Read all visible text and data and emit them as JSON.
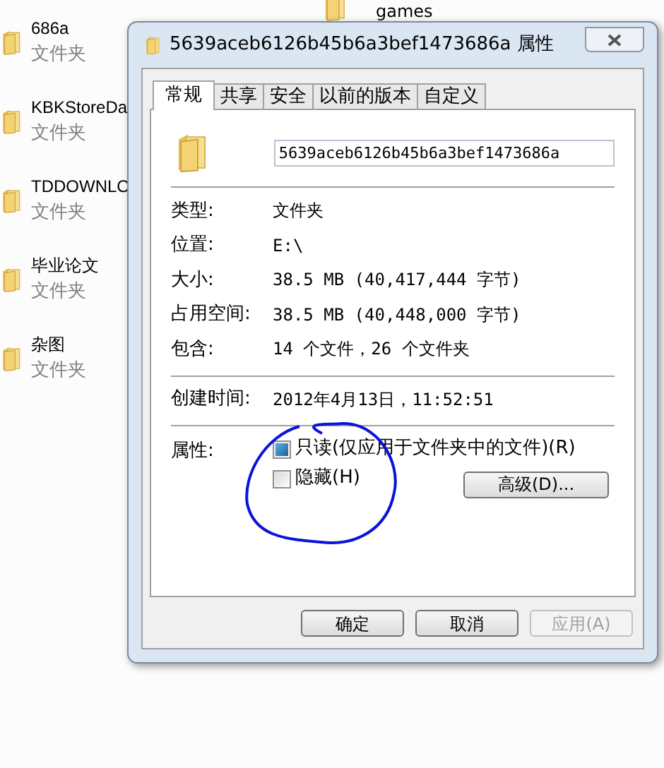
{
  "explorer": {
    "top_item": "games",
    "items": [
      {
        "name": "686a",
        "type": "文件夹"
      },
      {
        "name": "KBKStoreDa",
        "type": "文件夹"
      },
      {
        "name": "TDDOWNLO",
        "type": "文件夹"
      },
      {
        "name": "毕业论文",
        "type": "文件夹"
      },
      {
        "name": "杂图",
        "type": "文件夹"
      }
    ]
  },
  "dialog": {
    "title": "5639aceb6126b45b6a3bef1473686a 属性",
    "tabs": [
      {
        "label": "常规",
        "selected": true
      },
      {
        "label": "共享",
        "selected": false
      },
      {
        "label": "安全",
        "selected": false
      },
      {
        "label": "以前的版本",
        "selected": false
      },
      {
        "label": "自定义",
        "selected": false
      }
    ],
    "name_field": {
      "value": "5639aceb6126b45b6a3bef1473686a"
    },
    "properties": [
      {
        "label": "类型:",
        "value": "文件夹"
      },
      {
        "label": "位置:",
        "value": "E:\\"
      },
      {
        "label": "大小:",
        "value": "38.5 MB (40,417,444 字节)"
      },
      {
        "label": "占用空间:",
        "value": "38.5 MB (40,448,000 字节)"
      },
      {
        "label": "包含:",
        "value": "14 个文件，26 个文件夹"
      }
    ],
    "created": {
      "label": "创建时间:",
      "value": "2012年4月13日，11:52:51"
    },
    "attributes": {
      "label": "属性:",
      "options": [
        {
          "label": "只读(仅应用于文件夹中的文件)(R)",
          "checked": true
        },
        {
          "label": "隐藏(H)",
          "checked": false
        }
      ],
      "advanced_button": "高级(D)..."
    },
    "buttons": [
      {
        "label": "确定",
        "disabled": false
      },
      {
        "label": "取消",
        "disabled": false
      },
      {
        "label": "应用(A)",
        "disabled": true
      }
    ]
  }
}
